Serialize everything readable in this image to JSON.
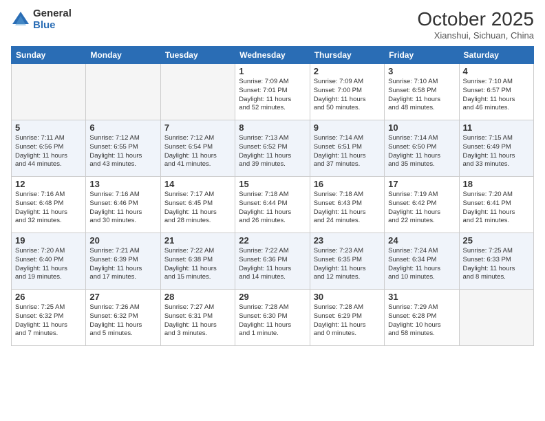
{
  "logo": {
    "general": "General",
    "blue": "Blue"
  },
  "header": {
    "title": "October 2025",
    "location": "Xianshui, Sichuan, China"
  },
  "weekdays": [
    "Sunday",
    "Monday",
    "Tuesday",
    "Wednesday",
    "Thursday",
    "Friday",
    "Saturday"
  ],
  "weeks": [
    [
      {
        "day": "",
        "info": ""
      },
      {
        "day": "",
        "info": ""
      },
      {
        "day": "",
        "info": ""
      },
      {
        "day": "1",
        "info": "Sunrise: 7:09 AM\nSunset: 7:01 PM\nDaylight: 11 hours\nand 52 minutes."
      },
      {
        "day": "2",
        "info": "Sunrise: 7:09 AM\nSunset: 7:00 PM\nDaylight: 11 hours\nand 50 minutes."
      },
      {
        "day": "3",
        "info": "Sunrise: 7:10 AM\nSunset: 6:58 PM\nDaylight: 11 hours\nand 48 minutes."
      },
      {
        "day": "4",
        "info": "Sunrise: 7:10 AM\nSunset: 6:57 PM\nDaylight: 11 hours\nand 46 minutes."
      }
    ],
    [
      {
        "day": "5",
        "info": "Sunrise: 7:11 AM\nSunset: 6:56 PM\nDaylight: 11 hours\nand 44 minutes."
      },
      {
        "day": "6",
        "info": "Sunrise: 7:12 AM\nSunset: 6:55 PM\nDaylight: 11 hours\nand 43 minutes."
      },
      {
        "day": "7",
        "info": "Sunrise: 7:12 AM\nSunset: 6:54 PM\nDaylight: 11 hours\nand 41 minutes."
      },
      {
        "day": "8",
        "info": "Sunrise: 7:13 AM\nSunset: 6:52 PM\nDaylight: 11 hours\nand 39 minutes."
      },
      {
        "day": "9",
        "info": "Sunrise: 7:14 AM\nSunset: 6:51 PM\nDaylight: 11 hours\nand 37 minutes."
      },
      {
        "day": "10",
        "info": "Sunrise: 7:14 AM\nSunset: 6:50 PM\nDaylight: 11 hours\nand 35 minutes."
      },
      {
        "day": "11",
        "info": "Sunrise: 7:15 AM\nSunset: 6:49 PM\nDaylight: 11 hours\nand 33 minutes."
      }
    ],
    [
      {
        "day": "12",
        "info": "Sunrise: 7:16 AM\nSunset: 6:48 PM\nDaylight: 11 hours\nand 32 minutes."
      },
      {
        "day": "13",
        "info": "Sunrise: 7:16 AM\nSunset: 6:46 PM\nDaylight: 11 hours\nand 30 minutes."
      },
      {
        "day": "14",
        "info": "Sunrise: 7:17 AM\nSunset: 6:45 PM\nDaylight: 11 hours\nand 28 minutes."
      },
      {
        "day": "15",
        "info": "Sunrise: 7:18 AM\nSunset: 6:44 PM\nDaylight: 11 hours\nand 26 minutes."
      },
      {
        "day": "16",
        "info": "Sunrise: 7:18 AM\nSunset: 6:43 PM\nDaylight: 11 hours\nand 24 minutes."
      },
      {
        "day": "17",
        "info": "Sunrise: 7:19 AM\nSunset: 6:42 PM\nDaylight: 11 hours\nand 22 minutes."
      },
      {
        "day": "18",
        "info": "Sunrise: 7:20 AM\nSunset: 6:41 PM\nDaylight: 11 hours\nand 21 minutes."
      }
    ],
    [
      {
        "day": "19",
        "info": "Sunrise: 7:20 AM\nSunset: 6:40 PM\nDaylight: 11 hours\nand 19 minutes."
      },
      {
        "day": "20",
        "info": "Sunrise: 7:21 AM\nSunset: 6:39 PM\nDaylight: 11 hours\nand 17 minutes."
      },
      {
        "day": "21",
        "info": "Sunrise: 7:22 AM\nSunset: 6:38 PM\nDaylight: 11 hours\nand 15 minutes."
      },
      {
        "day": "22",
        "info": "Sunrise: 7:22 AM\nSunset: 6:36 PM\nDaylight: 11 hours\nand 14 minutes."
      },
      {
        "day": "23",
        "info": "Sunrise: 7:23 AM\nSunset: 6:35 PM\nDaylight: 11 hours\nand 12 minutes."
      },
      {
        "day": "24",
        "info": "Sunrise: 7:24 AM\nSunset: 6:34 PM\nDaylight: 11 hours\nand 10 minutes."
      },
      {
        "day": "25",
        "info": "Sunrise: 7:25 AM\nSunset: 6:33 PM\nDaylight: 11 hours\nand 8 minutes."
      }
    ],
    [
      {
        "day": "26",
        "info": "Sunrise: 7:25 AM\nSunset: 6:32 PM\nDaylight: 11 hours\nand 7 minutes."
      },
      {
        "day": "27",
        "info": "Sunrise: 7:26 AM\nSunset: 6:32 PM\nDaylight: 11 hours\nand 5 minutes."
      },
      {
        "day": "28",
        "info": "Sunrise: 7:27 AM\nSunset: 6:31 PM\nDaylight: 11 hours\nand 3 minutes."
      },
      {
        "day": "29",
        "info": "Sunrise: 7:28 AM\nSunset: 6:30 PM\nDaylight: 11 hours\nand 1 minute."
      },
      {
        "day": "30",
        "info": "Sunrise: 7:28 AM\nSunset: 6:29 PM\nDaylight: 11 hours\nand 0 minutes."
      },
      {
        "day": "31",
        "info": "Sunrise: 7:29 AM\nSunset: 6:28 PM\nDaylight: 10 hours\nand 58 minutes."
      },
      {
        "day": "",
        "info": ""
      }
    ]
  ]
}
